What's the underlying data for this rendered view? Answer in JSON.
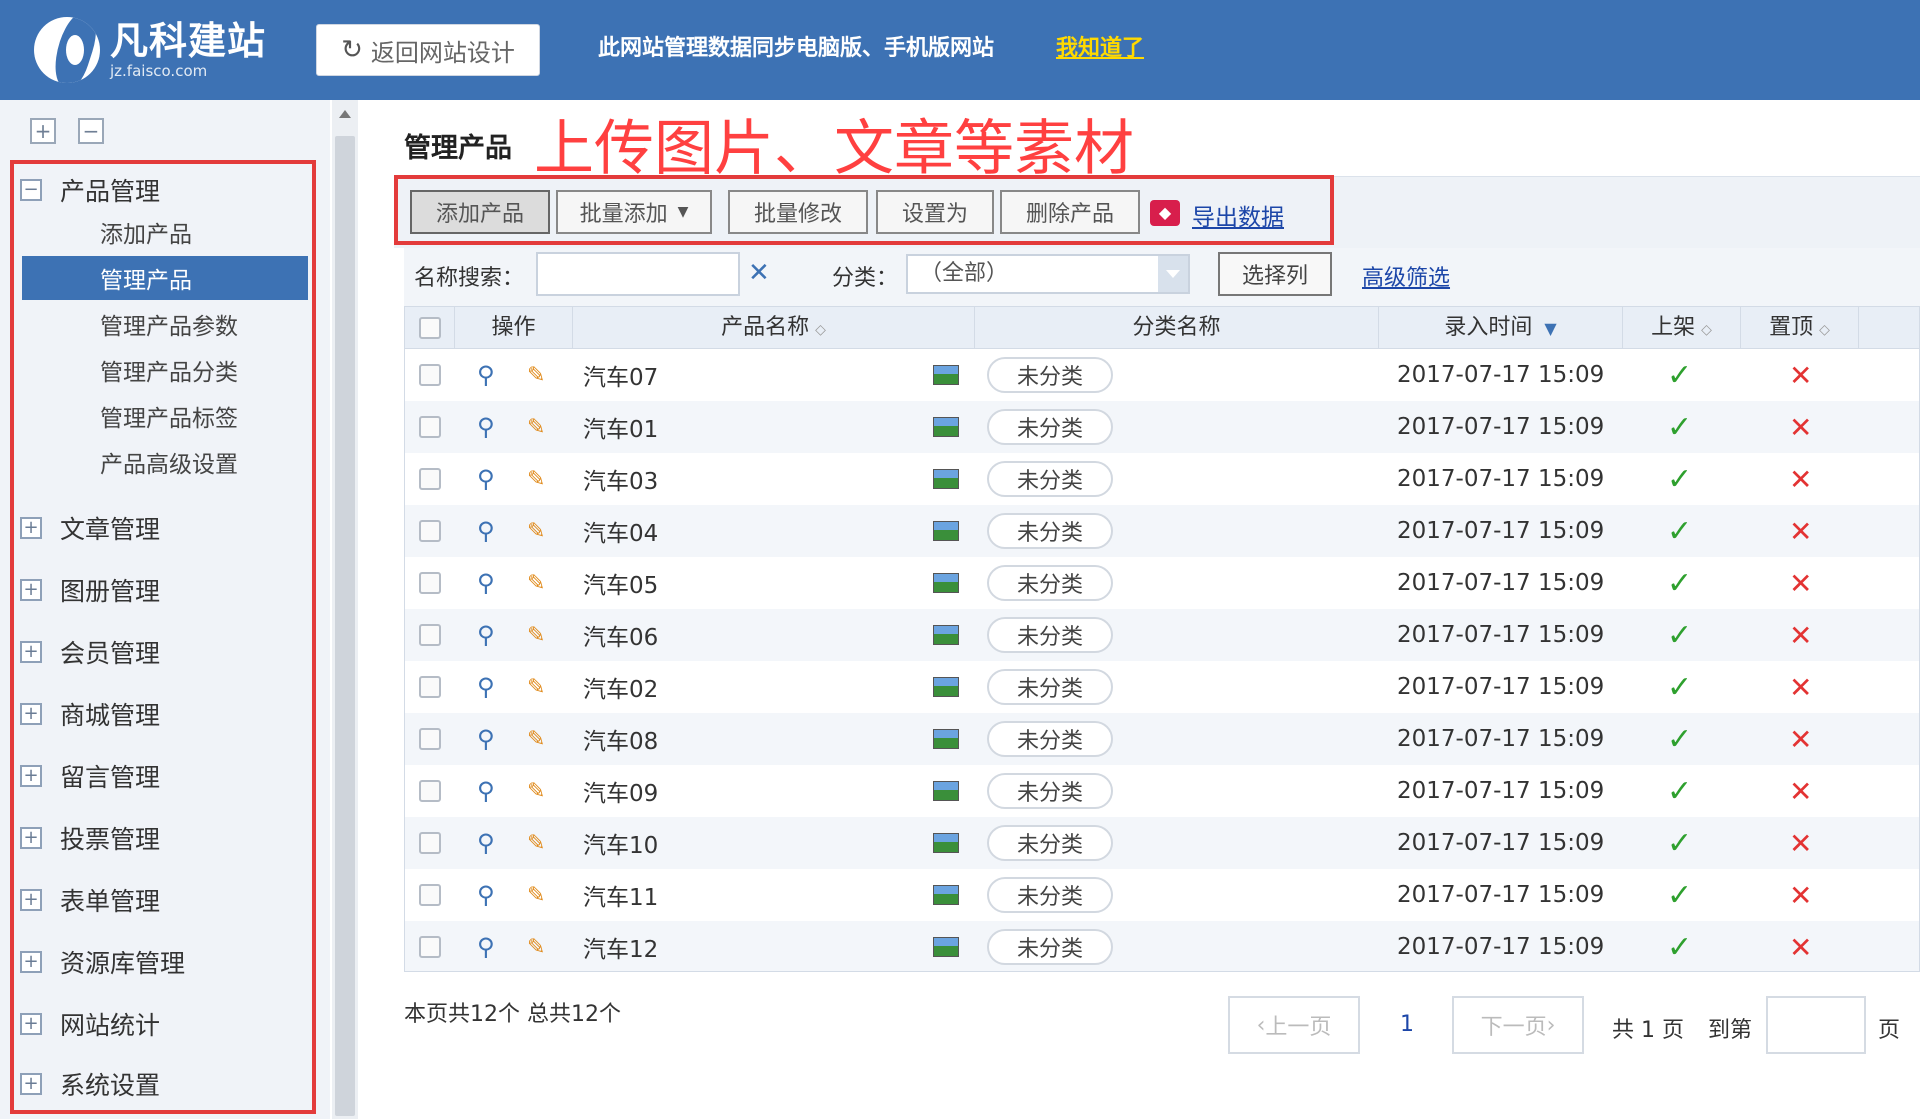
{
  "header": {
    "logo_name": "凡科建站",
    "logo_url": "jz.faisco.com",
    "back_button": "返回网站设计",
    "notice": "此网站管理数据同步电脑版、手机版网站",
    "notice_link": "我知道了"
  },
  "sidebar": {
    "expanded_group": "产品管理",
    "sub_items": [
      "添加产品",
      "管理产品",
      "管理产品参数",
      "管理产品分类",
      "管理产品标签",
      "产品高级设置"
    ],
    "active_sub": "管理产品",
    "groups": [
      "文章管理",
      "图册管理",
      "会员管理",
      "商城管理",
      "留言管理",
      "投票管理",
      "表单管理",
      "资源库管理",
      "网站统计",
      "系统设置"
    ]
  },
  "main": {
    "title": "管理产品",
    "annotation": "上传图片、文章等素材",
    "toolbar": {
      "add": "添加产品",
      "batch_add": "批量添加",
      "batch_edit": "批量修改",
      "set_as": "设置为",
      "delete": "删除产品",
      "export": "导出数据"
    },
    "filter": {
      "name_label": "名称搜索：",
      "name_value": "",
      "category_label": "分类：",
      "category_value": "（全部）",
      "choose_columns": "选择列",
      "advanced": "高级筛选"
    },
    "table": {
      "headers": {
        "action": "操作",
        "name": "产品名称",
        "category": "分类名称",
        "time": "录入时间",
        "listed": "上架",
        "pinned": "置顶"
      },
      "rows": [
        {
          "name": "汽车07",
          "category": "未分类",
          "time": "2017-07-17 15:09"
        },
        {
          "name": "汽车01",
          "category": "未分类",
          "time": "2017-07-17 15:09"
        },
        {
          "name": "汽车03",
          "category": "未分类",
          "time": "2017-07-17 15:09"
        },
        {
          "name": "汽车04",
          "category": "未分类",
          "time": "2017-07-17 15:09"
        },
        {
          "name": "汽车05",
          "category": "未分类",
          "time": "2017-07-17 15:09"
        },
        {
          "name": "汽车06",
          "category": "未分类",
          "time": "2017-07-17 15:09"
        },
        {
          "name": "汽车02",
          "category": "未分类",
          "time": "2017-07-17 15:09"
        },
        {
          "name": "汽车08",
          "category": "未分类",
          "time": "2017-07-17 15:09"
        },
        {
          "name": "汽车09",
          "category": "未分类",
          "time": "2017-07-17 15:09"
        },
        {
          "name": "汽车10",
          "category": "未分类",
          "time": "2017-07-17 15:09"
        },
        {
          "name": "汽车11",
          "category": "未分类",
          "time": "2017-07-17 15:09"
        },
        {
          "name": "汽车12",
          "category": "未分类",
          "time": "2017-07-17 15:09"
        }
      ]
    },
    "pagination": {
      "summary": "本页共12个 总共12个",
      "prev": "上一页",
      "current": "1",
      "next": "下一页",
      "total": "共 1 页",
      "goto": "到第",
      "unit": "页"
    }
  },
  "colors": {
    "header_bg": "#3d72b4",
    "accent": "#3d72b4",
    "highlight_box": "#e33b3b",
    "link": "#1c46a8"
  }
}
